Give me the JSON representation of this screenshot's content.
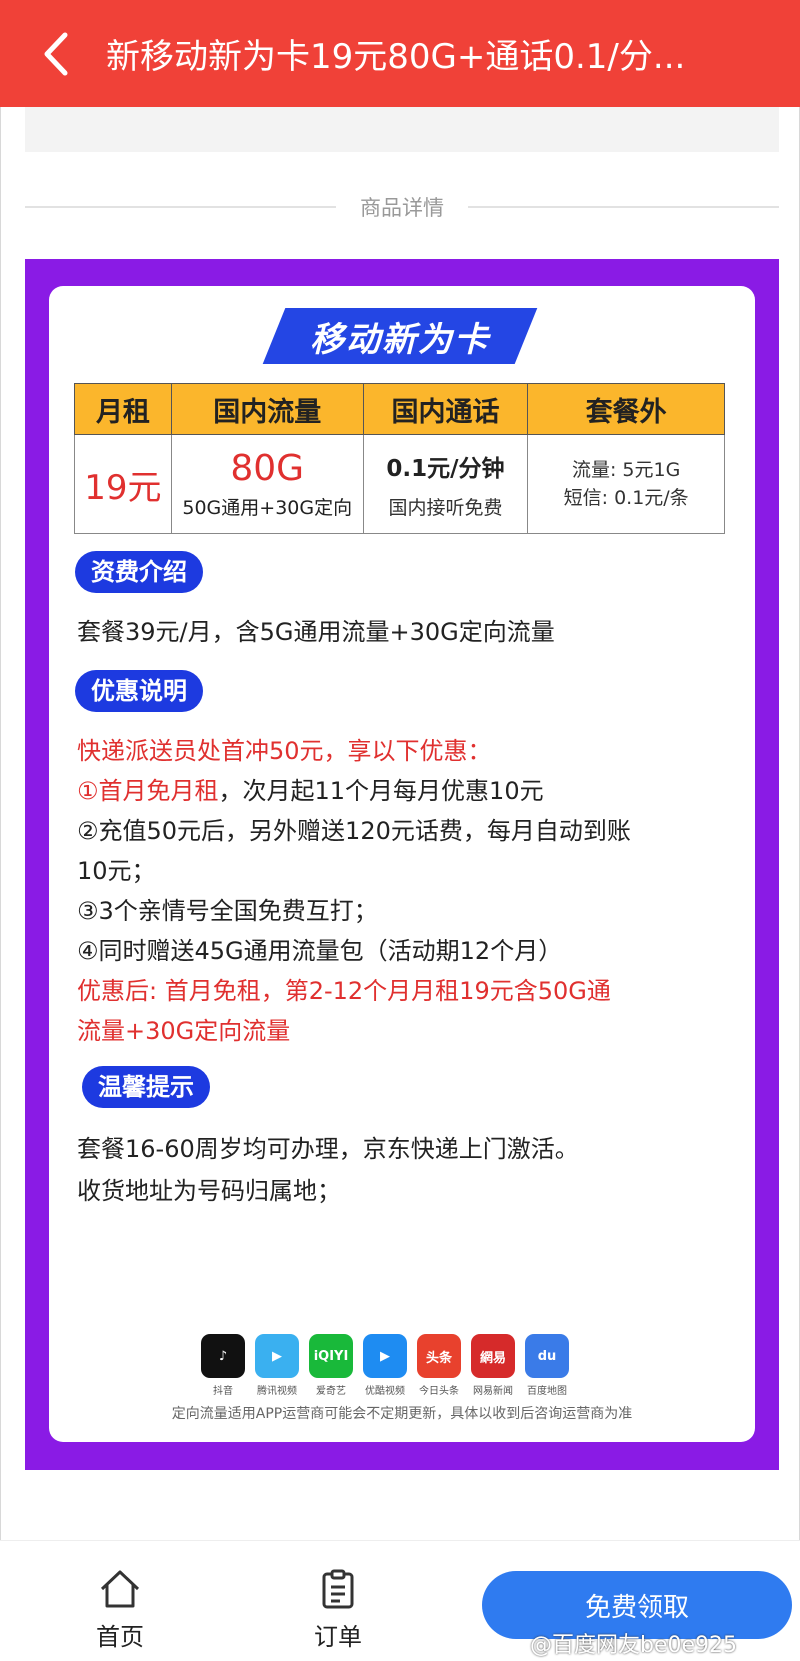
{
  "header": {
    "title": "新移动新为卡19元80G+通话0.1/分...",
    "back_icon": "chevron-left-icon"
  },
  "divider_label": "商品详情",
  "card": {
    "title": "移动新为卡",
    "table": {
      "headers": [
        "月租",
        "国内流量",
        "国内通话",
        "套餐外"
      ],
      "rent": "19元",
      "flow_main": "80G",
      "flow_sub": "50G通用+30G定向",
      "call_main": "0.1元/分钟",
      "call_sub": "国内接听免费",
      "extra_line1": "流量: 5元1G",
      "extra_line2": "短信: 0.1元/条"
    },
    "fee_intro": {
      "pill": "资费介绍",
      "text": "套餐39元/月，含5G通用流量+30G定向流量"
    },
    "offer": {
      "pill": "优惠说明",
      "lead": "快递派送员处首冲50元，享以下优惠：",
      "item1_red": "①首月免月租",
      "item1_rest": "，次月起11个月每月优惠10元",
      "item2_line1": "②充值50元后，另外赠送120元话费，每月自动到账",
      "item2_line2": "10元；",
      "item3": "③3个亲情号全国免费互打；",
      "item4": "④同时赠送45G通用流量包（活动期12个月）",
      "after_line1": "优惠后: 首月免租，第2-12个月月租19元含50G通",
      "after_line2": "流量+30G定向流量"
    },
    "tips": {
      "pill": "温馨提示",
      "line1": "套餐16-60周岁均可办理，京东快递上门激活。",
      "line2": "收货地址为号码归属地；"
    },
    "apps": [
      {
        "name": "抖音",
        "icon": "douyin-icon",
        "glyph": "♪",
        "color": "#111111"
      },
      {
        "name": "腾讯视频",
        "icon": "tencent-video-icon",
        "glyph": "▶",
        "color": "#3ab0f0"
      },
      {
        "name": "爱奇艺",
        "icon": "iqiyi-icon",
        "glyph": "iQIYI",
        "color": "#19b93a"
      },
      {
        "name": "优酷视频",
        "icon": "youku-icon",
        "glyph": "▶",
        "color": "#1e8cf2"
      },
      {
        "name": "今日头条",
        "icon": "toutiao-icon",
        "glyph": "头条",
        "color": "#e8412d"
      },
      {
        "name": "网易新闻",
        "icon": "netease-news-icon",
        "glyph": "網易",
        "color": "#d62a2a"
      },
      {
        "name": "百度地图",
        "icon": "baidu-map-icon",
        "glyph": "du",
        "color": "#3a7be8"
      }
    ],
    "footnote": "定向流量适用APP运营商可能会不定期更新，具体以收到后咨询运营商为准"
  },
  "bottom": {
    "home_label": "首页",
    "orders_label": "订单",
    "cta_label": "免费领取",
    "watermark": "@百度网友be0e925"
  }
}
